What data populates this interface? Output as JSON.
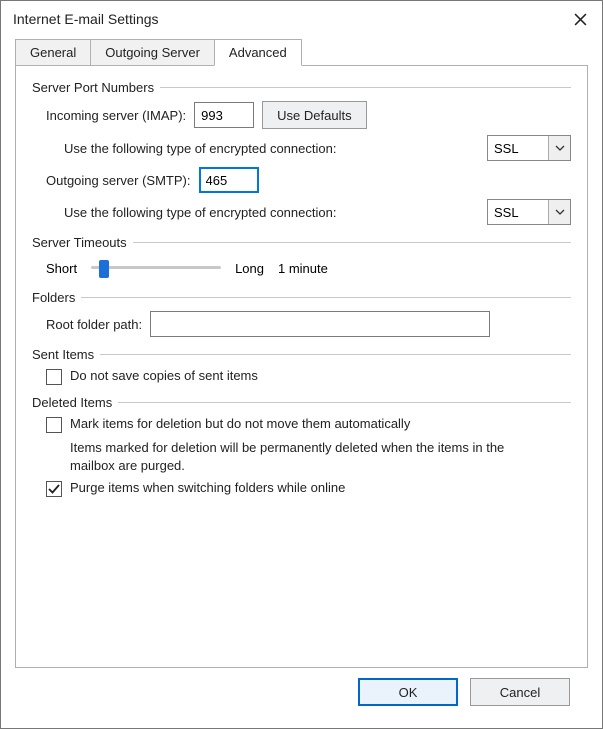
{
  "window": {
    "title": "Internet E-mail Settings"
  },
  "tabs": {
    "general": "General",
    "outgoing": "Outgoing Server",
    "advanced": "Advanced"
  },
  "group": {
    "ports": "Server Port Numbers",
    "timeouts": "Server Timeouts",
    "folders": "Folders",
    "sent": "Sent Items",
    "deleted": "Deleted Items"
  },
  "ports": {
    "incoming_label": "Incoming server (IMAP):",
    "incoming_value": "993",
    "defaults_btn": "Use Defaults",
    "encryption_label": "Use the following type of encrypted connection:",
    "incoming_encryption": "SSL",
    "outgoing_label": "Outgoing server (SMTP):",
    "outgoing_value": "465",
    "outgoing_encryption": "SSL"
  },
  "timeouts": {
    "short": "Short",
    "long": "Long",
    "value_text": "1 minute",
    "slider_percent": 10
  },
  "folders": {
    "root_label": "Root folder path:",
    "root_value": ""
  },
  "sent": {
    "dont_save_label": "Do not save copies of sent items",
    "dont_save_checked": false
  },
  "deleted": {
    "mark_label": "Mark items for deletion but do not move them automatically",
    "mark_checked": false,
    "note": "Items marked for deletion will be permanently deleted when the items in the mailbox are purged.",
    "purge_label": "Purge items when switching folders while online",
    "purge_checked": true
  },
  "footer": {
    "ok": "OK",
    "cancel": "Cancel"
  }
}
